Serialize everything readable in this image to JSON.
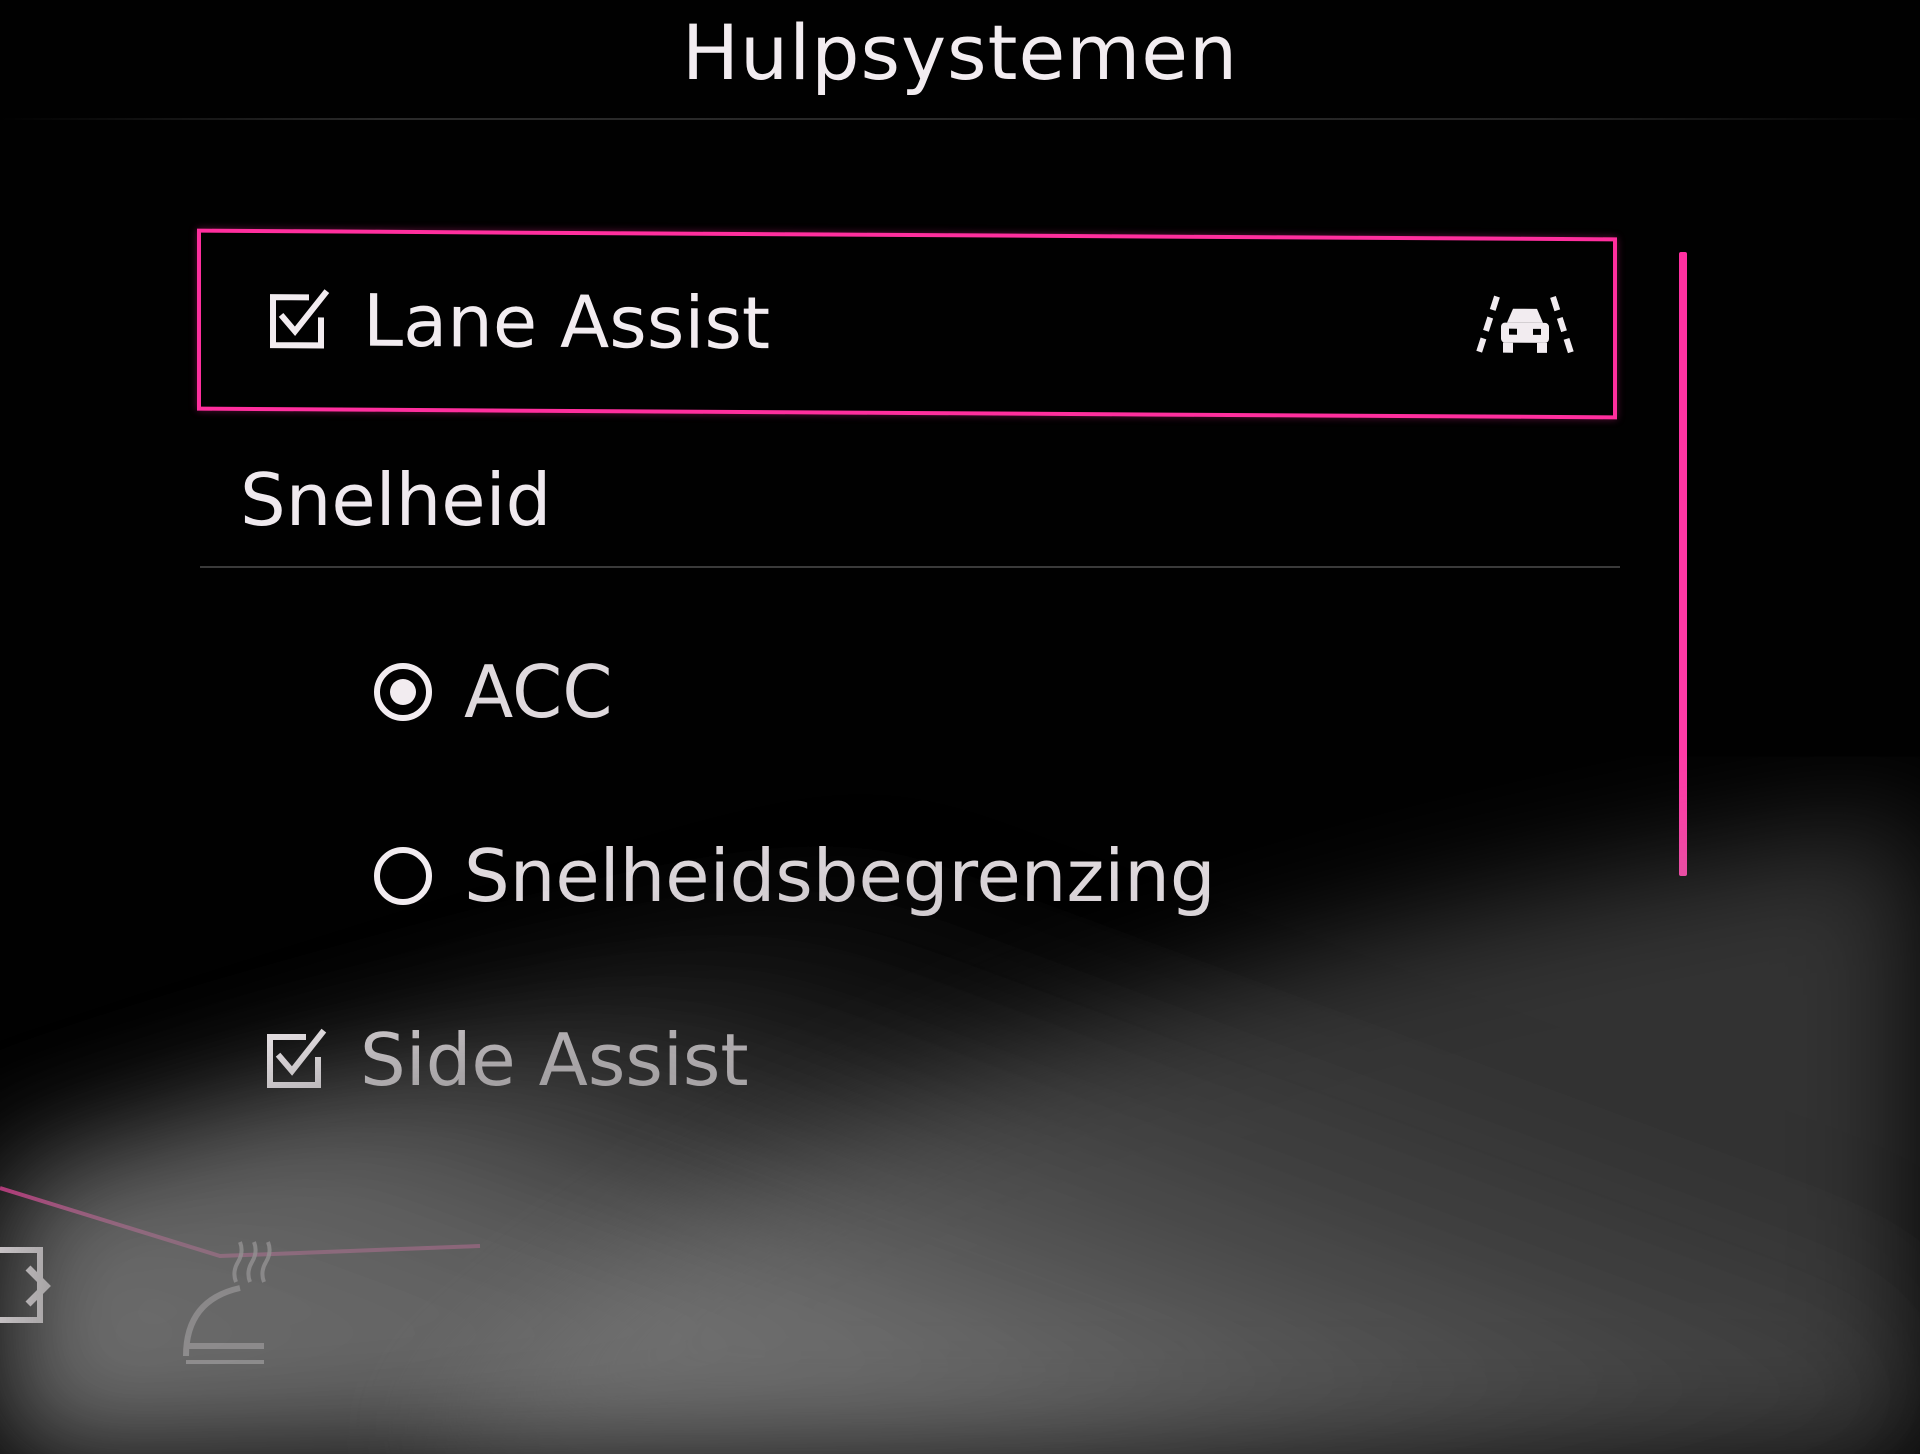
{
  "header": {
    "title": "Hulpsystemen"
  },
  "menu": {
    "lane_assist": {
      "label": "Lane Assist",
      "checked": true,
      "icon": "lane-assist-icon"
    },
    "speed_section": {
      "label": "Snelheid",
      "options": [
        {
          "label": "ACC",
          "selected": true
        },
        {
          "label": "Snelheidsbegrenzing",
          "selected": false
        }
      ]
    },
    "side_assist": {
      "label": "Side Assist",
      "checked": true
    }
  },
  "colors": {
    "accent": "#ff2f9e",
    "text": "#f2ecf0",
    "background": "#010101"
  },
  "cluster_icons": [
    "battery-icon",
    "rear-window-heating-icon"
  ]
}
